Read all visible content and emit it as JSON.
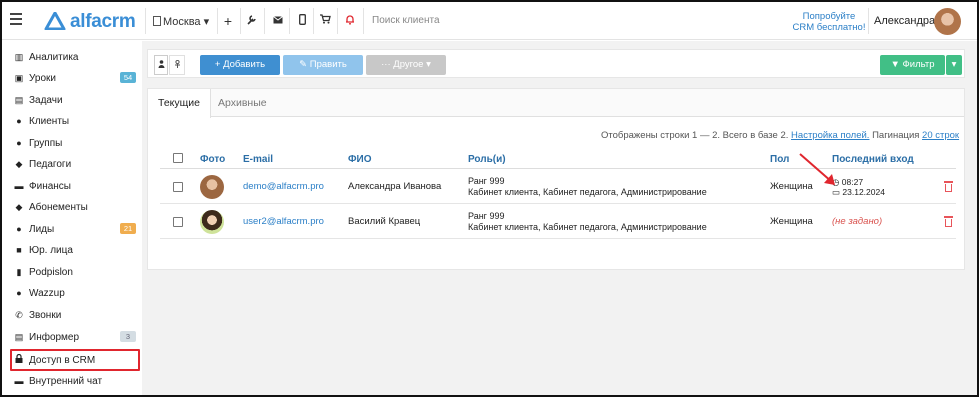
{
  "header": {
    "logo_text": "alfacrm",
    "branch": "Москва",
    "search_placeholder": "Поиск клиента",
    "try_line1": "Попробуйте",
    "try_line2": "CRM бесплатно!",
    "user_name": "Александра"
  },
  "sidebar": {
    "items": [
      {
        "label": "Аналитика",
        "icon": "book-icon"
      },
      {
        "label": "Уроки",
        "icon": "calendar-icon",
        "badge": "54"
      },
      {
        "label": "Задачи",
        "icon": "clipboard-icon"
      },
      {
        "label": "Клиенты",
        "icon": "user-icon"
      },
      {
        "label": "Группы",
        "icon": "users-icon"
      },
      {
        "label": "Педагоги",
        "icon": "graduation-cap-icon"
      },
      {
        "label": "Финансы",
        "icon": "money-icon"
      },
      {
        "label": "Абонементы",
        "icon": "tag-icon"
      },
      {
        "label": "Лиды",
        "icon": "user-plus-icon",
        "badge": "21"
      },
      {
        "label": "Юр. лица",
        "icon": "briefcase-icon"
      },
      {
        "label": "Podpislon",
        "icon": "file-icon"
      },
      {
        "label": "Wazzup",
        "icon": "whatsapp-icon"
      },
      {
        "label": "Звонки",
        "icon": "phone-icon"
      },
      {
        "label": "Информер",
        "icon": "list-icon",
        "badge": "3"
      },
      {
        "label": "Доступ в CRM",
        "icon": "lock-icon"
      },
      {
        "label": "Внутренний чат",
        "icon": "chat-icon"
      }
    ]
  },
  "toolbar": {
    "add": "+ Добавить",
    "edit": "✎ Править",
    "other": "··· Другое ▾",
    "filter": "▼ Фильтр"
  },
  "tabs": [
    "Текущие",
    "Архивные"
  ],
  "info": {
    "text": "Отображены строки 1 — 2. Всего в базе 2.",
    "settings_link": "Настройка полей.",
    "pagination_label": "Пагинация",
    "pagination_value": "20 строк"
  },
  "table": {
    "columns": [
      "Фото",
      "E-mail",
      "ФИО",
      "Роль(и)",
      "Пол",
      "Последний вход"
    ],
    "rows": [
      {
        "email": "demo@alfacrm.pro",
        "name": "Александра Иванова",
        "rank": "Ранг 999",
        "roles": "Кабинет клиента, Кабинет педагога, Администрирование",
        "gender": "Женщина",
        "login_time": "08:27",
        "login_date": "23.12.2024"
      },
      {
        "email": "user2@alfacrm.pro",
        "name": "Василий Кравец",
        "rank": "Ранг 999",
        "roles": "Кабинет клиента, Кабинет педагога, Администрирование",
        "gender": "Женщина",
        "login_none": "(не задано)"
      }
    ]
  },
  "colors": {
    "accent": "#3f8fd1",
    "filter": "#41bf86",
    "highlight": "#e0262e",
    "delete": "#e8545a"
  }
}
